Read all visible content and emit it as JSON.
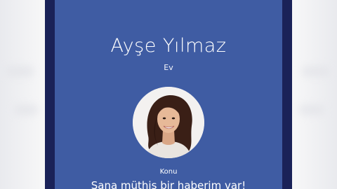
{
  "caller": {
    "name": "Ayşe Yılmaz",
    "label": "Ev",
    "avatar_icon": "person-photo-icon"
  },
  "message": {
    "subject_label": "Konu",
    "subject_text": "Sana müthiş bir haberim var!"
  },
  "colors": {
    "screen_bg": "#3f5ca3",
    "frame": "#1a2258",
    "text": "#ffffff"
  }
}
